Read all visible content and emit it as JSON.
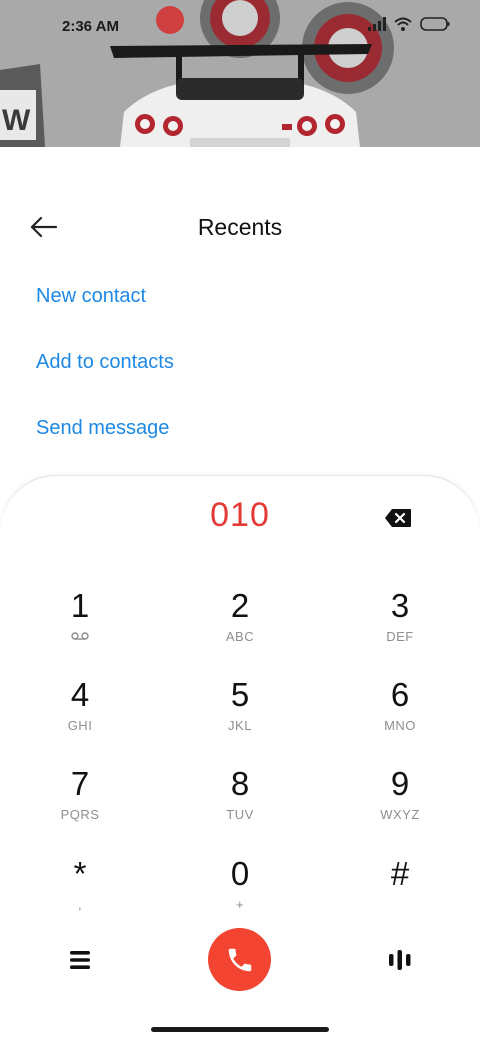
{
  "status_bar": {
    "time": "2:36 AM"
  },
  "header": {
    "back_icon": "arrow-left-icon",
    "title": "Recents"
  },
  "actions": {
    "new_contact": "New contact",
    "add_to_contacts": "Add to contacts",
    "send_message": "Send message"
  },
  "dialer": {
    "number": "010",
    "backspace_icon": "backspace-icon",
    "keys": [
      {
        "digit": "1",
        "letters": ""
      },
      {
        "digit": "2",
        "letters": "ABC"
      },
      {
        "digit": "3",
        "letters": "DEF"
      },
      {
        "digit": "4",
        "letters": "GHI"
      },
      {
        "digit": "5",
        "letters": "JKL"
      },
      {
        "digit": "6",
        "letters": "MNO"
      },
      {
        "digit": "7",
        "letters": "PQRS"
      },
      {
        "digit": "8",
        "letters": "TUV"
      },
      {
        "digit": "9",
        "letters": "WXYZ"
      },
      {
        "digit": "*",
        "letters": ","
      },
      {
        "digit": "0",
        "letters": "+"
      },
      {
        "digit": "#",
        "letters": ""
      }
    ],
    "menu_icon": "menu-icon",
    "call_icon": "phone-icon",
    "dtmf_icon": "keypad-bars-icon"
  },
  "colors": {
    "accent_link": "#1e88e5",
    "number": "#e53935",
    "call_button": "#f24430"
  }
}
